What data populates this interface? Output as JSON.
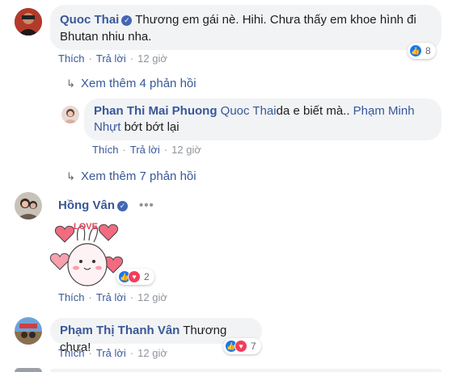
{
  "comments": [
    {
      "author": "Quoc Thai",
      "text_line1": "Thương em gái nè. Hihi. Chưa thấy em khoe hình đi",
      "text_line2": "Bhutan nhiu nha.",
      "like": "Thích",
      "reply": "Trả lời",
      "time": "12 giờ",
      "reactions": "8"
    },
    {
      "author": "Phan Thi Mai Phuong",
      "mention_part1": "Quoc Thai",
      "text_part1": "da e biết mà..",
      "mention_part2": "Phạm Minh",
      "mention_part3": "Nhựt",
      "text_part2": "bớt bớt lại",
      "like": "Thích",
      "reply": "Trả lời",
      "time": "12 giờ"
    },
    {
      "author": "Hồng Vân",
      "sticker_text": "LOVE",
      "like": "Thích",
      "reply": "Trả lời",
      "time": "12 giờ",
      "reactions": "2"
    },
    {
      "author": "Phạm Thị Thanh Vân",
      "text": "Thương chưa!",
      "like": "Thích",
      "reply": "Trả lời",
      "time": "12 giờ",
      "reactions": "7"
    }
  ],
  "more_replies_1": "Xem thêm 4 phản hồi",
  "more_replies_2": "Xem thêm 7 phản hồi",
  "colors": {
    "link": "#385898",
    "bubble": "#f2f3f5",
    "meta": "#90949c",
    "like": "#1877f2",
    "love": "#f33e58"
  }
}
